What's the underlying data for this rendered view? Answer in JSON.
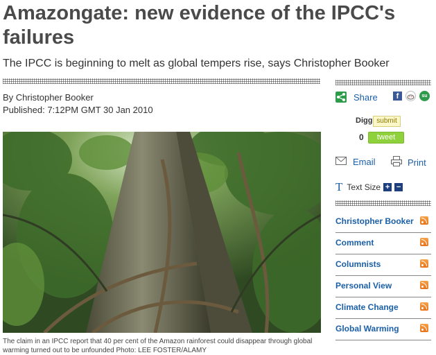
{
  "article": {
    "headline": "Amazongate: new evidence of the IPCC's failures",
    "standfirst": "The IPCC is beginning to melt as global tempers rise, says Christopher Booker",
    "byline": "By Christopher Booker",
    "published": "Published: 7:12PM GMT 30 Jan 2010",
    "caption": "The claim in an IPCC report that 40 per cent of the Amazon rainforest could disappear through global warming turned out to be unfounded   Photo: LEE FOSTER/ALAMY"
  },
  "sidebar": {
    "share_label": "Share",
    "digg_label": "Digg",
    "digg_button": "submit",
    "tweet_count": "0",
    "tweet_button": "tweet",
    "email_label": "Email",
    "print_label": "Print",
    "text_size_label": "Text Size",
    "text_size_plus": "+",
    "text_size_minus": "−",
    "topics": [
      {
        "label": "Christopher Booker"
      },
      {
        "label": "Comment"
      },
      {
        "label": "Columnists"
      },
      {
        "label": "Personal View"
      },
      {
        "label": "Climate Change"
      },
      {
        "label": "Global Warming"
      }
    ]
  },
  "icons": {
    "share": "share-icon",
    "facebook": "facebook-icon",
    "reddit": "reddit-icon",
    "stumbleupon": "stumbleupon-icon",
    "email": "envelope-icon",
    "print": "printer-icon",
    "text_size": "text-size-icon",
    "rss": "rss-icon"
  },
  "colors": {
    "link_blue": "#1a5fa8",
    "tweet_green": "#8fd13c",
    "rss_orange": "#f08a2c",
    "headline_gray": "#4a4a4a"
  }
}
